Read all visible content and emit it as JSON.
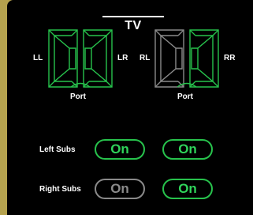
{
  "header": {
    "title": "TV"
  },
  "speakers": {
    "front": {
      "left_label": "LL",
      "right_label": "LR",
      "port_label": "Port",
      "left_color": "#27c24c",
      "right_color": "#27c24c"
    },
    "rear": {
      "left_label": "RL",
      "right_label": "RR",
      "port_label": "Port",
      "left_color": "#8a8a8a",
      "right_color": "#27c24c"
    }
  },
  "subs": {
    "left": {
      "label": "Left Subs",
      "button_1": "On",
      "button_2": "On",
      "button_1_state": "on",
      "button_2_state": "on"
    },
    "right": {
      "label": "Right Subs",
      "button_1": "On",
      "button_2": "On",
      "button_1_state": "off",
      "button_2_state": "on"
    }
  },
  "colors": {
    "active": "#27c24c",
    "inactive": "#8a8a8a",
    "background": "#000000",
    "frame": "#b5a24e"
  }
}
